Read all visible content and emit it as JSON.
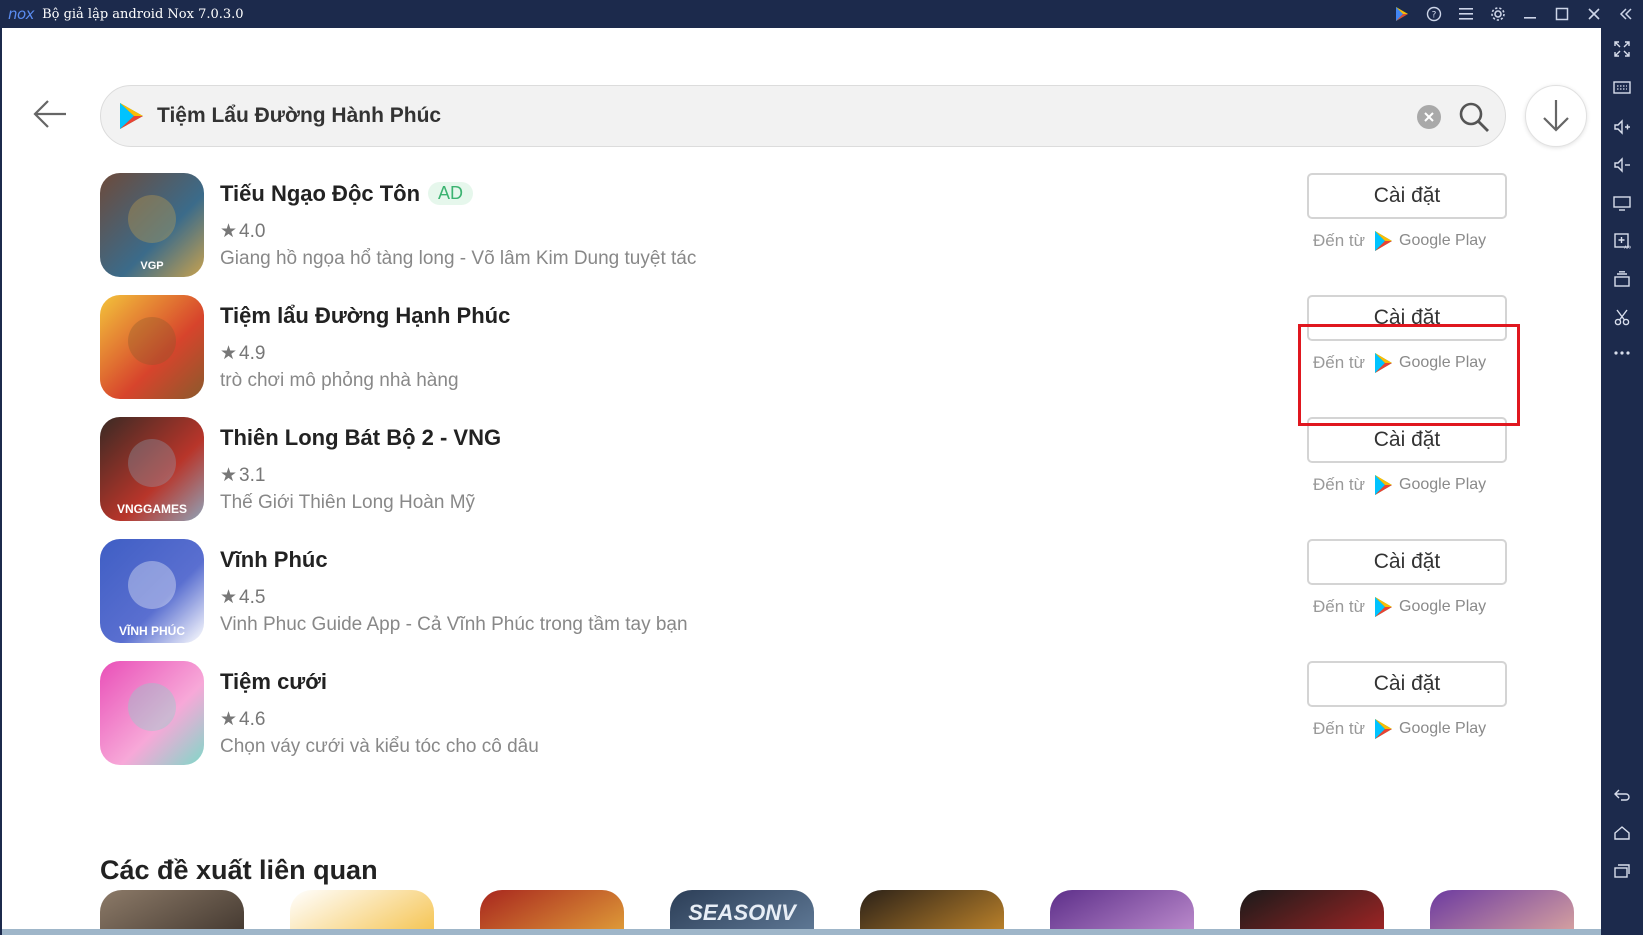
{
  "window": {
    "logo": "nox",
    "title": "Bộ giả lập android Nox 7.0.3.0",
    "title_icons": [
      "play-store-icon",
      "help-icon",
      "menu-icon",
      "settings-icon",
      "minimize-icon",
      "maximize-icon",
      "close-icon",
      "collapse-icon"
    ]
  },
  "sidebar_tools": [
    "fullscreen-icon",
    "keyboard-icon",
    "volume-up-icon",
    "volume-down-icon",
    "screen-icon",
    "apk-install-icon",
    "multi-instance-icon",
    "scissors-icon",
    "more-icon",
    "back-nav-icon",
    "home-nav-icon",
    "recent-apps-icon"
  ],
  "search": {
    "query": "Tiệm Lẩu Đường Hành Phúc"
  },
  "apps": [
    {
      "name": "Tiếu Ngạo Độc Tôn",
      "ad": "AD",
      "rating": "4.0",
      "desc": "Giang hồ ngọa hổ tàng long - Võ lâm Kim Dung tuyệt tác",
      "icon_label": "VGP",
      "icon_colors": [
        "#6d4a3a",
        "#3b6b8a",
        "#c9a24e"
      ],
      "install_label": "Cài đặt",
      "source_prefix": "Đến từ",
      "source_store": "Google Play"
    },
    {
      "name": "Tiệm lẩu Đường Hạnh Phúc",
      "rating": "4.9",
      "desc": "trò chơi mô phỏng nhà hàng",
      "icon_label": "",
      "icon_colors": [
        "#f3c33b",
        "#d7442c",
        "#8a5a2c"
      ],
      "install_label": "Cài đặt",
      "source_prefix": "Đến từ",
      "source_store": "Google Play"
    },
    {
      "name": "Thiên Long Bát Bộ 2 - VNG",
      "rating": "3.1",
      "desc": "Thế Giới Thiên Long Hoàn Mỹ",
      "icon_label": "VNGGAMES",
      "icon_colors": [
        "#3a2a24",
        "#b8352a",
        "#8fa3b8"
      ],
      "install_label": "Cài đặt",
      "source_prefix": "Đến từ",
      "source_store": "Google Play"
    },
    {
      "name": "Vĩnh Phúc",
      "rating": "4.5",
      "desc": "Vinh Phuc Guide App - Cả Vĩnh Phúc trong tầm tay bạn",
      "icon_label": "VĨNH PHÚC",
      "icon_colors": [
        "#3f5ec4",
        "#5a6fd0",
        "#ffffff"
      ],
      "install_label": "Cài đặt",
      "source_prefix": "Đến từ",
      "source_store": "Google Play"
    },
    {
      "name": "Tiệm cưới",
      "rating": "4.6",
      "desc": "Chọn váy cưới và kiểu tóc cho cô dâu",
      "icon_label": "",
      "icon_colors": [
        "#e94fb8",
        "#f7a8d8",
        "#7fd8c8"
      ],
      "install_label": "Cài đặt",
      "source_prefix": "Đến từ",
      "source_store": "Google Play"
    }
  ],
  "highlighted_app_index": 1,
  "related": {
    "title": "Các đề xuất liên quan",
    "icons": [
      {
        "label": "",
        "colors": [
          "#8c7a68",
          "#2f2620"
        ]
      },
      {
        "label": "",
        "colors": [
          "#ffffff",
          "#f2b21c"
        ]
      },
      {
        "label": "",
        "colors": [
          "#a8261e",
          "#f0c040"
        ]
      },
      {
        "label": "SEASONV",
        "colors": [
          "#2c3e57",
          "#6e8aa8"
        ]
      },
      {
        "label": "",
        "colors": [
          "#2b2118",
          "#e8a030"
        ]
      },
      {
        "label": "",
        "colors": [
          "#5d2f8a",
          "#d9a7e0"
        ]
      },
      {
        "label": "",
        "colors": [
          "#1a1a1a",
          "#c82828"
        ]
      },
      {
        "label": "",
        "colors": [
          "#6c3aa0",
          "#f6c1a0"
        ]
      }
    ]
  },
  "colors": {
    "chrome": "#1c2a4c",
    "highlight": "#e0171f",
    "ad_badge": "#3cb371"
  }
}
